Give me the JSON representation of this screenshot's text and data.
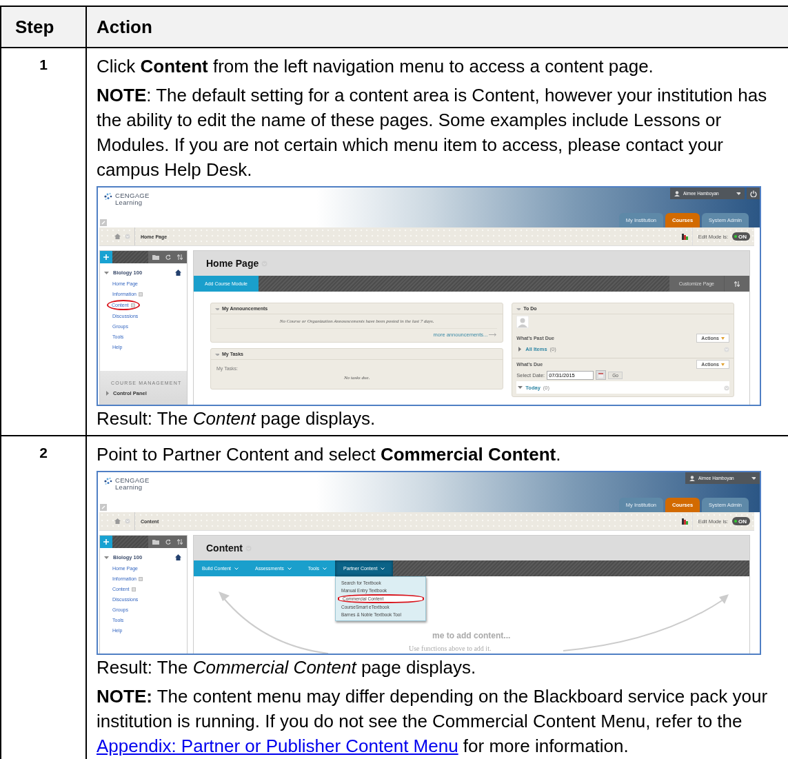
{
  "table": {
    "columns": [
      "Step",
      "Action"
    ],
    "rows": [
      {
        "step": "1",
        "blocks": [
          {
            "kind": "text",
            "text": "Click **Content** from the left navigation menu to access a content page."
          },
          {
            "kind": "text",
            "text": "**NOTE**: The default setting for a content area is Content, however your institution has the ability to edit the name of these pages. Some examples include Lessons or Modules. If you are not certain which menu item to access, please contact your campus Help Desk."
          },
          {
            "kind": "screenshot",
            "screen": {
              "logo": [
                "CENGAGE",
                "Learning"
              ],
              "user": "Aimee Hamboyan",
              "power": true,
              "tabs": [
                {
                  "label": "My Institution",
                  "selected": false
                },
                {
                  "label": "Courses",
                  "selected": true
                },
                {
                  "label": "System Admin",
                  "selected": false
                }
              ],
              "breadcrumb": "Home Page",
              "edit_mode": {
                "label": "Edit Mode is:",
                "text": "ON",
                "on": true
              },
              "course_menu": {
                "title": "Biology 100",
                "items": [
                  {
                    "label": "Home Page",
                    "kind": "page",
                    "circled": false
                  },
                  {
                    "label": "Information",
                    "kind": "area",
                    "circled": false
                  },
                  {
                    "label": "Content",
                    "kind": "area",
                    "circled": true
                  },
                  {
                    "label": "Discussions",
                    "kind": "page",
                    "circled": false
                  },
                  {
                    "label": "Groups",
                    "kind": "page",
                    "circled": false
                  },
                  {
                    "label": "Tools",
                    "kind": "page",
                    "circled": false
                  },
                  {
                    "label": "Help",
                    "kind": "page",
                    "circled": false
                  }
                ],
                "management": {
                  "heading": "COURSE MANAGEMENT",
                  "item": "Control Panel"
                }
              },
              "page_title": "Home Page",
              "action_bar": {
                "items": [
                  {
                    "label": "Add Course Module",
                    "kind": "button"
                  }
                ],
                "right": "Customize Page"
              },
              "main": {
                "kind": "modules",
                "announcements": {
                  "title": "My Announcements",
                  "message": "No Course or Organization Announcements have been posted in the last 7 days.",
                  "link": "more announcements..."
                },
                "tasks": {
                  "title": "My Tasks",
                  "label": "My Tasks:",
                  "message": "No tasks due."
                },
                "todo": {
                  "title": "To Do",
                  "sections": [
                    {
                      "heading": "What's Past Due",
                      "action": "Actions",
                      "row": {
                        "label": "All Items",
                        "count": "(0)",
                        "expanded": false
                      }
                    },
                    {
                      "heading": "What's Due",
                      "action": "Actions",
                      "date_label": "Select Date:",
                      "date": "07/31/2015",
                      "go": "Go",
                      "row": {
                        "label": "Today",
                        "count": "(0)",
                        "expanded": true
                      }
                    }
                  ]
                }
              }
            }
          },
          {
            "kind": "text",
            "text": "Result: The *Content* page displays."
          }
        ]
      },
      {
        "step": "2",
        "blocks": [
          {
            "kind": "text",
            "text": "Point to Partner Content and select **Commercial Content**."
          },
          {
            "kind": "screenshot",
            "screen": {
              "logo": [
                "CENGAGE",
                "Learning"
              ],
              "user": "Aimee Hamboyan",
              "power": false,
              "tabs": [
                {
                  "label": "My Institution",
                  "selected": false
                },
                {
                  "label": "Courses",
                  "selected": true
                },
                {
                  "label": "System Admin",
                  "selected": false
                }
              ],
              "breadcrumb": "Content",
              "edit_mode": {
                "label": "Edit Mode is:",
                "text": "ON",
                "on": true
              },
              "course_menu": {
                "title": "Biology 100",
                "items": [
                  {
                    "label": "Home Page",
                    "kind": "page",
                    "circled": false
                  },
                  {
                    "label": "Information",
                    "kind": "area",
                    "circled": false
                  },
                  {
                    "label": "Content",
                    "kind": "area",
                    "circled": false
                  },
                  {
                    "label": "Discussions",
                    "kind": "page",
                    "circled": false
                  },
                  {
                    "label": "Groups",
                    "kind": "page",
                    "circled": false
                  },
                  {
                    "label": "Tools",
                    "kind": "page",
                    "circled": false
                  },
                  {
                    "label": "Help",
                    "kind": "page",
                    "circled": false
                  }
                ]
              },
              "page_title": "Content",
              "action_bar": {
                "items": [
                  {
                    "label": "Build Content",
                    "kind": "menu",
                    "selected": false
                  },
                  {
                    "label": "Assessments",
                    "kind": "menu",
                    "selected": false
                  },
                  {
                    "label": "Tools",
                    "kind": "menu",
                    "selected": false
                  },
                  {
                    "label": "Partner Content",
                    "kind": "menu",
                    "selected": true,
                    "dropdown": [
                      {
                        "label": "Search for Textbook",
                        "circled": false
                      },
                      {
                        "label": "Manual Entry Textbook",
                        "circled": false
                      },
                      {
                        "label": "Commercial Content",
                        "circled": true
                      },
                      {
                        "label": "CourseSmart eTextbook",
                        "circled": false
                      },
                      {
                        "label": "Barnes & Noble Textbook Tool",
                        "circled": false
                      }
                    ]
                  }
                ]
              },
              "main": {
                "kind": "empty",
                "heading": "me to add content...",
                "subtext": "Use functions above to add it."
              }
            }
          },
          {
            "kind": "text",
            "text": "Result: The *Commercial Content* page displays."
          },
          {
            "kind": "text",
            "text": "**NOTE:** The content menu may differ depending on the Blackboard service pack your institution is running. If you do not see the Commercial Content Menu, refer to the ",
            "link": "Appendix: Partner or Publisher Content Menu",
            "after": " for more information."
          }
        ]
      }
    ]
  }
}
